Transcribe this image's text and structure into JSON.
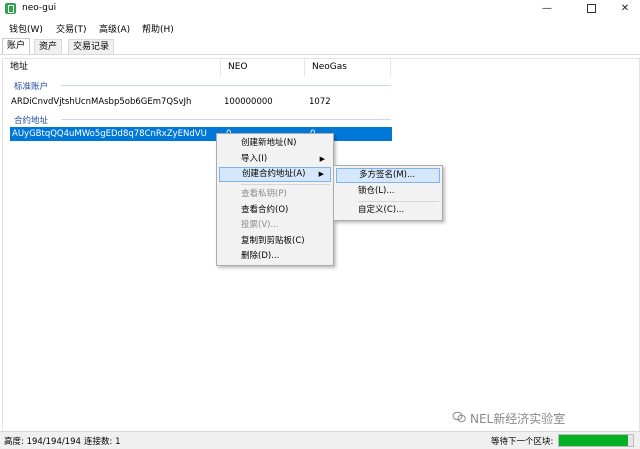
{
  "window": {
    "title": "neo-gui",
    "minimize": "—",
    "close": "✕"
  },
  "menu": [
    "钱包(W)",
    "交易(T)",
    "高级(A)",
    "帮助(H)"
  ],
  "tabs": [
    "账户",
    "资产",
    "交易记录"
  ],
  "columns": [
    "地址",
    "NEO",
    "NeoGas"
  ],
  "groups": {
    "standard": "标准账户",
    "contract": "合约地址"
  },
  "rows": {
    "standard": {
      "address": "ARDiCnvdVjtshUcnMAsbp5ob6GEm7QSvJh",
      "neo": "100000000",
      "gas": "1072"
    },
    "contract": {
      "address": "AUyGBtqQQ4uMWo5gEDd8q78CnRxZyENdVU",
      "neo": "0",
      "gas": "0"
    }
  },
  "context_menu": {
    "items": [
      {
        "label": "创建新地址(N)",
        "enabled": true
      },
      {
        "label": "导入(I)",
        "enabled": true,
        "submenu": true
      },
      {
        "label": "创建合约地址(A)",
        "enabled": true,
        "submenu": true,
        "highlighted": true
      },
      {
        "label": "查看私钥(P)",
        "enabled": false
      },
      {
        "label": "查看合约(O)",
        "enabled": true
      },
      {
        "label": "投票(V)...",
        "enabled": false
      },
      {
        "label": "复制到剪贴板(C)",
        "enabled": true
      },
      {
        "label": "删除(D)...",
        "enabled": true
      }
    ],
    "arrow": "▶"
  },
  "submenu": {
    "items": [
      {
        "label": "多方签名(M)...",
        "highlighted": true
      },
      {
        "label": "锁仓(L)..."
      },
      {
        "label": "自定义(C)..."
      }
    ]
  },
  "status": {
    "height_label": "高度: 194/194/194",
    "connected_label": "连接数: 1",
    "next_block_label": "等待下一个区块:",
    "progress_fraction": 0.93
  },
  "watermark": "NEL新经济实验室",
  "colors": {
    "selection": "#0078d7",
    "group_label": "#1f4e9c",
    "progress": "#06b025"
  }
}
